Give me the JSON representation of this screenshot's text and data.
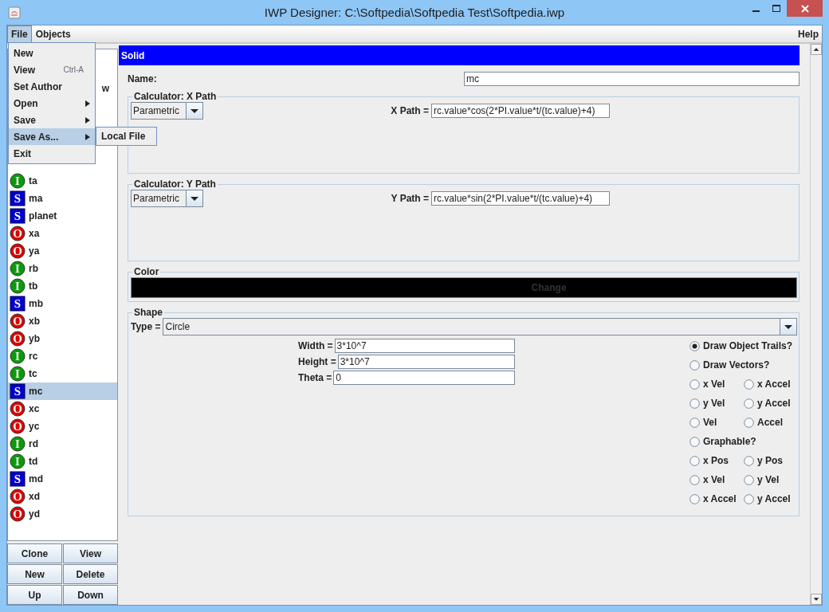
{
  "window": {
    "title": "IWP Designer: C:\\Softpedia\\Softpedia Test\\Softpedia.iwp"
  },
  "menubar": [
    {
      "label": "File",
      "selected": true
    },
    {
      "label": "Objects",
      "selected": false
    }
  ],
  "help_menu": "Help",
  "file_menu": {
    "items": [
      {
        "label": "New",
        "submenu": false,
        "selected": false
      },
      {
        "label": "View",
        "shortcut": "Ctrl-A",
        "submenu": false,
        "selected": false
      },
      {
        "label": "Set Author",
        "submenu": false,
        "selected": false
      },
      {
        "label": "Open",
        "submenu": true,
        "selected": false
      },
      {
        "label": "Save",
        "submenu": true,
        "selected": false
      },
      {
        "label": "Save As...",
        "submenu": true,
        "selected": true
      },
      {
        "label": "Exit",
        "submenu": false,
        "selected": false
      }
    ],
    "submenu": [
      "Local File"
    ]
  },
  "objects": {
    "hidden_fragment": "w",
    "items": [
      {
        "badge": "I",
        "kind": "input",
        "label": "ta",
        "selected": false
      },
      {
        "badge": "S",
        "kind": "solid",
        "label": "ma",
        "selected": false
      },
      {
        "badge": "S",
        "kind": "solid",
        "label": "planet",
        "selected": false
      },
      {
        "badge": "O",
        "kind": "output",
        "label": "xa",
        "selected": false
      },
      {
        "badge": "O",
        "kind": "output",
        "label": "ya",
        "selected": false
      },
      {
        "badge": "I",
        "kind": "input",
        "label": "rb",
        "selected": false
      },
      {
        "badge": "I",
        "kind": "input",
        "label": "tb",
        "selected": false
      },
      {
        "badge": "S",
        "kind": "solid",
        "label": "mb",
        "selected": false
      },
      {
        "badge": "O",
        "kind": "output",
        "label": "xb",
        "selected": false
      },
      {
        "badge": "O",
        "kind": "output",
        "label": "yb",
        "selected": false
      },
      {
        "badge": "I",
        "kind": "input",
        "label": "rc",
        "selected": false
      },
      {
        "badge": "I",
        "kind": "input",
        "label": "tc",
        "selected": false
      },
      {
        "badge": "S",
        "kind": "solid",
        "label": "mc",
        "selected": true
      },
      {
        "badge": "O",
        "kind": "output",
        "label": "xc",
        "selected": false
      },
      {
        "badge": "O",
        "kind": "output",
        "label": "yc",
        "selected": false
      },
      {
        "badge": "I",
        "kind": "input",
        "label": "rd",
        "selected": false
      },
      {
        "badge": "I",
        "kind": "input",
        "label": "td",
        "selected": false
      },
      {
        "badge": "S",
        "kind": "solid",
        "label": "md",
        "selected": false
      },
      {
        "badge": "O",
        "kind": "output",
        "label": "xd",
        "selected": false
      },
      {
        "badge": "O",
        "kind": "output",
        "label": "yd",
        "selected": false
      }
    ],
    "buttons": [
      "Clone",
      "View",
      "New",
      "Delete",
      "Up",
      "Down"
    ]
  },
  "editor": {
    "header": "Solid",
    "name_label": "Name:",
    "name_value": "mc",
    "calculators": [
      {
        "title": "Calculator: X Path",
        "mode": "Parametric",
        "label": "X Path =",
        "value": "rc.value*cos(2*PI.value*t/(tc.value)+4)"
      },
      {
        "title": "Calculator: Y Path",
        "mode": "Parametric",
        "label": "Y Path =",
        "value": "rc.value*sin(2*PI.value*t/(tc.value)+4)"
      }
    ],
    "color": {
      "title": "Color",
      "button": "Change",
      "color": "#000000"
    },
    "shape": {
      "title": "Shape",
      "type_label": "Type =",
      "type_value": "Circle",
      "fields": [
        {
          "label": "Width =",
          "value": "3*10^7"
        },
        {
          "label": "Height =",
          "value": "3*10^7"
        },
        {
          "label": "Theta =",
          "value": "0"
        }
      ],
      "options": [
        [
          {
            "label": "Draw Object Trails?",
            "selected": true
          }
        ],
        [
          {
            "label": "Draw Vectors?",
            "selected": false
          }
        ],
        [
          {
            "label": "x Vel",
            "selected": false
          },
          {
            "label": "x Accel",
            "selected": false
          }
        ],
        [
          {
            "label": "y Vel",
            "selected": false
          },
          {
            "label": "y Accel",
            "selected": false
          }
        ],
        [
          {
            "label": "Vel",
            "selected": false
          },
          {
            "label": "Accel",
            "selected": false
          }
        ],
        [
          {
            "label": "Graphable?",
            "selected": false
          }
        ],
        [
          {
            "label": "x Pos",
            "selected": false
          },
          {
            "label": "y Pos",
            "selected": false
          }
        ],
        [
          {
            "label": "x Vel",
            "selected": false
          },
          {
            "label": "y Vel",
            "selected": false
          }
        ],
        [
          {
            "label": "x Accel",
            "selected": false
          },
          {
            "label": "y Accel",
            "selected": false
          }
        ]
      ]
    }
  }
}
